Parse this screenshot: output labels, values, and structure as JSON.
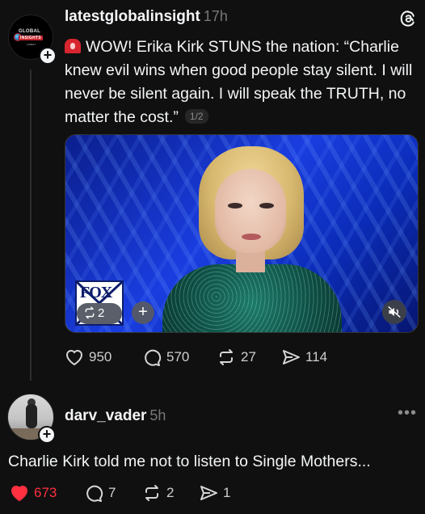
{
  "post": {
    "author": "latestglobalinsight",
    "time": "17h",
    "avatar": {
      "line1": "GLOBAL",
      "line2": "INSIGHTS",
      "line3": "LATEST"
    },
    "text": "WOW! Erika Kirk STUNS the nation: “Charlie knew evil wins when good people stay silent. I will never be silent again. I will speak the TRUTH, no matter the cost.”",
    "pager": "1/2",
    "video": {
      "channel_logo": "FOX",
      "repost_count": "2"
    },
    "stats": {
      "likes": "950",
      "replies": "570",
      "reposts": "27",
      "shares": "114"
    }
  },
  "reply": {
    "author": "darv_vader",
    "time": "5h",
    "text": "Charlie Kirk told me not to listen to Single Mothers...",
    "more": "•••",
    "stats": {
      "likes": "673",
      "replies": "7",
      "reposts": "2",
      "shares": "1"
    }
  },
  "colors": {
    "background": "#101010",
    "like_active": "#ff3040",
    "text_secondary": "#777777"
  },
  "icons": [
    "threads-logo-icon",
    "siren-icon",
    "heart-icon",
    "comment-icon",
    "repost-icon",
    "share-icon",
    "mute-icon",
    "plus-icon",
    "more-icon"
  ]
}
